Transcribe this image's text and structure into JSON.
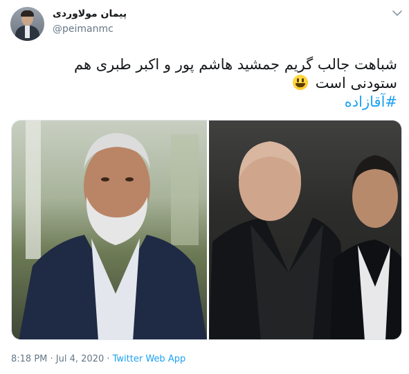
{
  "user": {
    "display_name": "پیمان مولاوردی",
    "handle": "@peimanmc"
  },
  "tweet": {
    "line1": "شباهت جالب گریم جمشید هاشم پور و اکبر طبری هم",
    "line2": "ستودنی است",
    "hashtag": "#آقازاده",
    "emoji": "grinning-face-emoji"
  },
  "media": {
    "photo_left": "bearded-man-in-suit-photo",
    "photo_right": "two-men-in-suits-photo"
  },
  "meta": {
    "time": "8:18 PM",
    "separator1": " · ",
    "date": "Jul 4, 2020",
    "separator2": " · ",
    "source": "Twitter Web App"
  },
  "icons": {
    "menu": "chevron-down-icon"
  },
  "colors": {
    "link": "#1da1f2",
    "secondary_text": "#657786",
    "text": "#14171a"
  }
}
